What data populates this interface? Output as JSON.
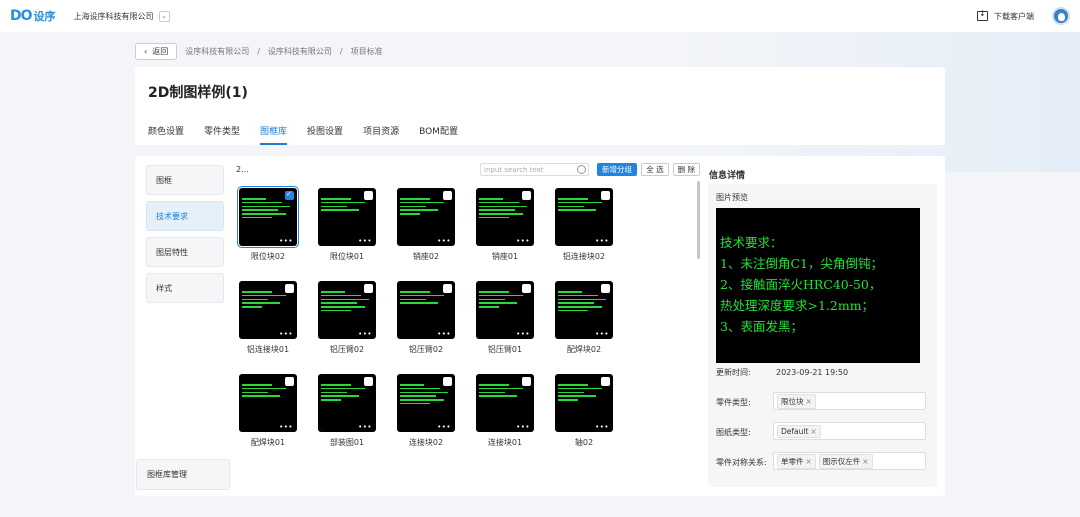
{
  "topbar": {
    "logo_mark": "DO",
    "logo_text": "设序",
    "company": "上海设序科技有限公司",
    "download_label": "下载客户端"
  },
  "breadcrumb": {
    "back_label": "返回",
    "items": [
      "设序科技有限公司",
      "设序科技有限公司",
      "项目标准"
    ]
  },
  "page": {
    "title": "2D制图样例(1)",
    "tabs": [
      "颜色设置",
      "零件类型",
      "图框库",
      "投图设置",
      "项目资源",
      "BOM配置"
    ],
    "active_tab": "图框库"
  },
  "sidebar": {
    "items": [
      "图框",
      "技术要求",
      "图层特性",
      "样式"
    ],
    "active": "技术要求",
    "manage_label": "图框库管理"
  },
  "toolbar": {
    "group_label": "2...",
    "search_placeholder": "input search text",
    "new_group_label": "新增分组",
    "select_all_label": "全 选",
    "delete_label": "删 除"
  },
  "grid": {
    "items": [
      {
        "label": "限位块02",
        "selected": true
      },
      {
        "label": "限位块01",
        "selected": false
      },
      {
        "label": "销座02",
        "selected": false
      },
      {
        "label": "销座01",
        "selected": false
      },
      {
        "label": "铝连接块02",
        "selected": false
      },
      {
        "label": "铝连接块01",
        "selected": false
      },
      {
        "label": "铝压臂02",
        "selected": false
      },
      {
        "label": "铝压臂02",
        "selected": false
      },
      {
        "label": "铝压臂01",
        "selected": false
      },
      {
        "label": "配焊块02",
        "selected": false
      },
      {
        "label": "配焊块01",
        "selected": false
      },
      {
        "label": "部装图01",
        "selected": false
      },
      {
        "label": "连接块02",
        "selected": false
      },
      {
        "label": "连接块01",
        "selected": false
      },
      {
        "label": "轴02",
        "selected": false
      }
    ],
    "more_icon": "more-dots-icon"
  },
  "info": {
    "title": "信息详情",
    "preview_label": "图片预览",
    "preview_lines": [
      "技术要求：",
      "1、未注倒角C1，尖角倒钝；",
      "2、接触面淬火HRC40-50，",
      "热处理深度要求>1.2mm；",
      "3、表面发黑；"
    ],
    "update_label": "更新时间:",
    "update_time": "2023-09-21 19:50",
    "part_type_label": "零件类型:",
    "part_type_tags": [
      "限位块"
    ],
    "drawing_type_label": "图纸类型:",
    "drawing_type_tags": [
      "Default"
    ],
    "relation_label": "零件对称关系:",
    "relation_tags": [
      "单零件",
      "图示仅左件"
    ]
  },
  "colors": {
    "accent": "#2185e0",
    "preview_text": "#22e038"
  }
}
